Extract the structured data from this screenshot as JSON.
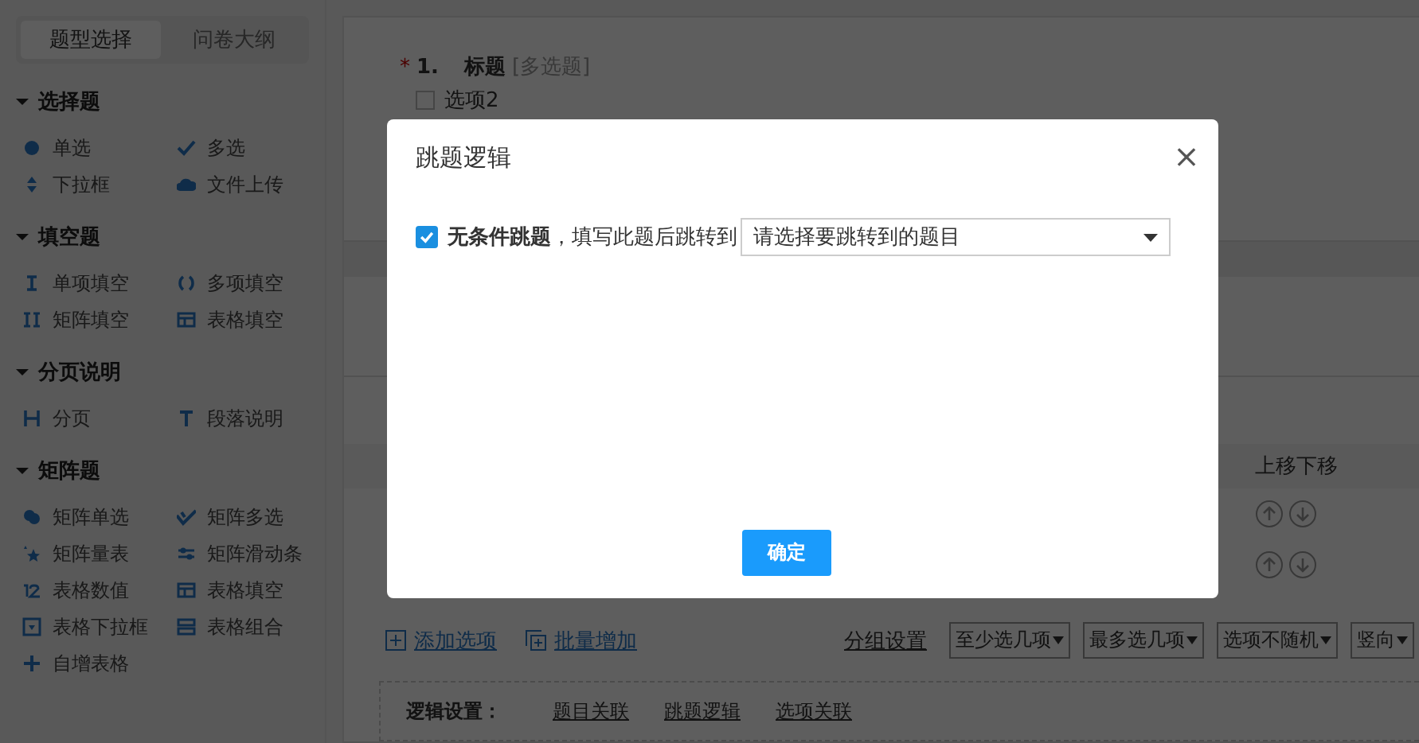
{
  "sidebar": {
    "tabs": [
      {
        "label": "题型选择",
        "selected": true
      },
      {
        "label": "问卷大纲",
        "selected": false
      }
    ],
    "sections": [
      {
        "title": "选择题",
        "expanded": true,
        "items": [
          "单选",
          "多选",
          "下拉框",
          "文件上传"
        ]
      },
      {
        "title": "填空题",
        "expanded": true,
        "items": [
          "单项填空",
          "多项填空",
          "矩阵填空",
          "表格填空"
        ]
      },
      {
        "title": "分页说明",
        "expanded": true,
        "items": [
          "分页",
          "段落说明"
        ]
      },
      {
        "title": "矩阵题",
        "expanded": true,
        "items": [
          "矩阵单选",
          "矩阵多选",
          "矩阵量表",
          "矩阵滑动条",
          "表格数值",
          "表格填空",
          "表格下拉框",
          "表格组合",
          "自增表格"
        ]
      }
    ]
  },
  "question": {
    "required_mark": "*",
    "number": "1.",
    "title": "标题",
    "type": "[多选题]",
    "option": {
      "label": "选项2",
      "checked": false
    }
  },
  "table": {
    "column_header": "上移下移"
  },
  "toolbar": {
    "links": [
      "添加选项",
      "批量增加"
    ],
    "group": "分组设置",
    "dropdowns": [
      "至少选几项",
      "最多选几项",
      "选项不随机",
      "竖向"
    ]
  },
  "logic": {
    "label": "逻辑设置：",
    "links": [
      "题目关联",
      "跳题逻辑",
      "选项关联"
    ]
  },
  "dialog": {
    "title": "跳题逻辑",
    "close": "×",
    "checkbox": {
      "checked": true,
      "label": "无条件跳题",
      "suffix": "，填写此题后跳转到"
    },
    "select": {
      "placeholder": "请选择要跳转到的题目"
    },
    "button": "确定"
  }
}
